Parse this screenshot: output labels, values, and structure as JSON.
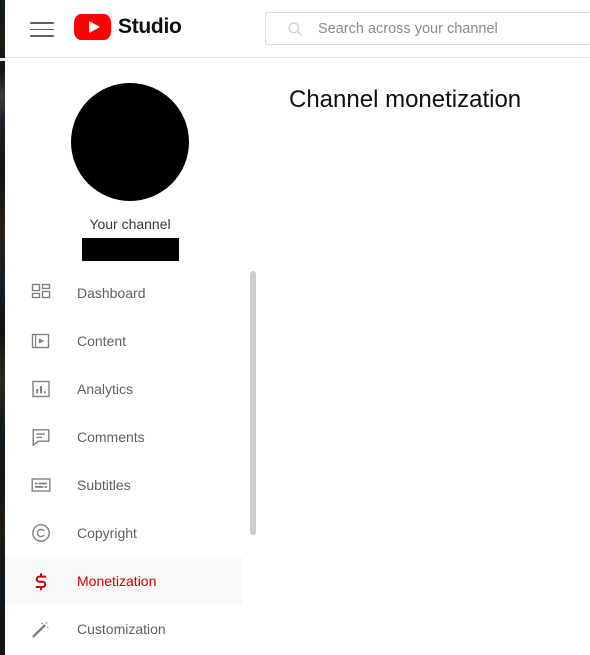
{
  "header": {
    "menu_icon": "hamburger-menu-icon",
    "brand": {
      "logo_icon": "youtube-logo-icon",
      "name": "Studio",
      "logo_color": "#ff0000"
    },
    "search": {
      "icon": "search-icon",
      "placeholder": "Search across your channel",
      "value": ""
    }
  },
  "sidebar": {
    "channel": {
      "avatar_icon": "channel-avatar",
      "caption": "Your channel",
      "name_redacted": true
    },
    "items": [
      {
        "id": "dashboard",
        "label": "Dashboard",
        "icon": "dashboard-grid-icon",
        "active": false
      },
      {
        "id": "content",
        "label": "Content",
        "icon": "video-frame-icon",
        "active": false
      },
      {
        "id": "analytics",
        "label": "Analytics",
        "icon": "bar-chart-icon",
        "active": false
      },
      {
        "id": "comments",
        "label": "Comments",
        "icon": "comment-bubble-icon",
        "active": false
      },
      {
        "id": "subtitles",
        "label": "Subtitles",
        "icon": "subtitles-icon",
        "active": false
      },
      {
        "id": "copyright",
        "label": "Copyright",
        "icon": "copyright-icon",
        "active": false
      },
      {
        "id": "monetization",
        "label": "Monetization",
        "icon": "dollar-sign-icon",
        "active": true
      },
      {
        "id": "customization",
        "label": "Customization",
        "icon": "magic-wand-icon",
        "active": false
      }
    ],
    "active_color": "#cc0000",
    "scrollbar": {
      "visible": true
    }
  },
  "main": {
    "title": "Channel monetization"
  }
}
